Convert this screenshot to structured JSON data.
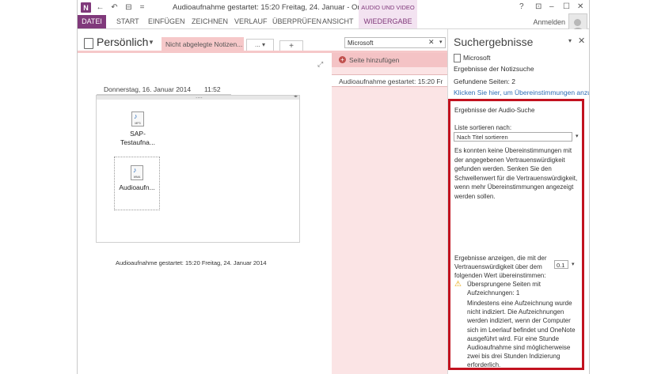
{
  "window": {
    "title": "Audioaufnahme gestartet: 15:20 Freitag, 24. Januar - OneNote (Test)",
    "context_group": "AUDIO UND VIDEO",
    "help": "?",
    "ribbon_display": "⊡",
    "minimize": "–",
    "maximize": "☐",
    "close": "✕"
  },
  "qat": {
    "app": "N",
    "back": "←",
    "undo": "↶",
    "dock": "⊟",
    "more": "="
  },
  "ribbon": {
    "tabs": [
      "DATEI",
      "START",
      "EINFÜGEN",
      "ZEICHNEN",
      "VERLAUF",
      "ÜBERPRÜFEN",
      "ANSICHT",
      "WIEDERGABE"
    ],
    "sign_in": "Anmelden"
  },
  "notebook": {
    "name": "Persönlich",
    "active_section": "Nicht abgelegte Notizen...",
    "more_sections": "... ▾",
    "add_section": "+"
  },
  "search": {
    "value": "Microsoft",
    "clear": "✕",
    "dropdown": "▾"
  },
  "page": {
    "date": "Donnerstag, 16. Januar 2014",
    "time": "11:52",
    "note_handle": "....",
    "note_arrows": "◂▸",
    "files": [
      {
        "ext": "MP3",
        "label_line1": "SAP-",
        "label_line2": "Testaufna..."
      },
      {
        "ext": "WMA",
        "label_line1": "Audioaufn...",
        "label_line2": ""
      }
    ],
    "caption": "Audioaufnahme gestartet: 15:20 Freitag, 24. Januar 2014"
  },
  "pagelist": {
    "add_page": "Seite hinzufügen",
    "add_icon": "+",
    "pages": [
      "Audioaufnahme gestartet: 15:20 Fr"
    ]
  },
  "pane": {
    "title": "Suchergebnisse",
    "pin": "▾",
    "close": "✕",
    "scope": "Microsoft",
    "scope_sub": "Ergebnisse der Notizsuche",
    "found_pages": "Gefundene Seiten: 2",
    "matches_link": "Klicken Sie hier, um Übereinstimmungen anzu",
    "audio": {
      "title": "Ergebnisse der Audio-Suche",
      "sort_label": "Liste sortieren nach:",
      "sort_value": "Nach Titel sortieren",
      "sort_dd": "▾",
      "no_matches": "Es konnten keine Übereinstimmungen mit der angegebenen Vertrauenswürdigkeit gefunden werden. Senken Sie den Schwellenwert für die Vertrauenswürdigkeit, wenn mehr Übereinstimmungen angezeigt werden sollen.",
      "threshold_label": "Ergebnisse anzeigen, die mit der Vertrauenswürdigkeit über dem folgenden Wert übereinstimmen:",
      "threshold_value": "0.1",
      "threshold_dd": "▾",
      "warn": "⚠",
      "skipped": "Übersprungene Seiten mit Aufzeichnungen: 1",
      "index_note": "Mindestens eine Aufzeichnung wurde nicht indiziert. Die Aufzeichnungen werden indiziert, wenn der Computer sich im Leerlauf befindet und OneNote ausgeführt wird. Für eine Stunde Audioaufnahme sind möglicherweise zwei bis drei Stunden Indizierung erforderlich."
    }
  },
  "colors": {
    "accent": "#80397b",
    "section_tab": "#f6c8c9",
    "highlight_border": "#c2121f",
    "link": "#2e6db4"
  }
}
